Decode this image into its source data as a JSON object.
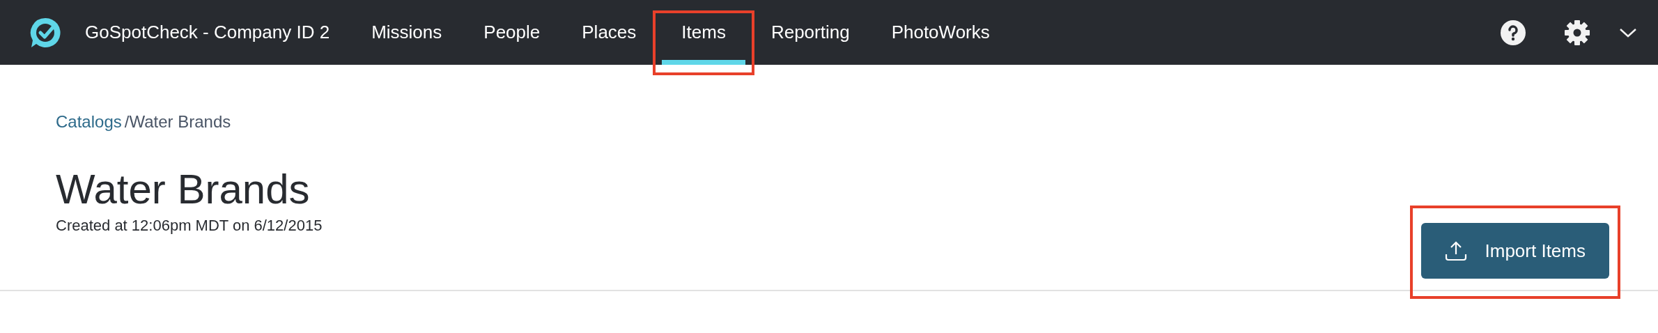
{
  "nav": {
    "brand": "GoSpotCheck - Company ID 2",
    "tabs": [
      {
        "label": "Missions",
        "selected": false,
        "highlighted": false
      },
      {
        "label": "People",
        "selected": false,
        "highlighted": false
      },
      {
        "label": "Places",
        "selected": false,
        "highlighted": false
      },
      {
        "label": "Items",
        "selected": true,
        "highlighted": true
      },
      {
        "label": "Reporting",
        "selected": false,
        "highlighted": false
      },
      {
        "label": "PhotoWorks",
        "selected": false,
        "highlighted": false
      }
    ]
  },
  "breadcrumb": {
    "link": "Catalogs",
    "separator": "/",
    "current": "Water Brands"
  },
  "header": {
    "title": "Water Brands",
    "subtitle": "Created at 12:06pm MDT on 6/12/2015"
  },
  "import_button": {
    "label": "Import Items",
    "highlighted": true
  }
}
